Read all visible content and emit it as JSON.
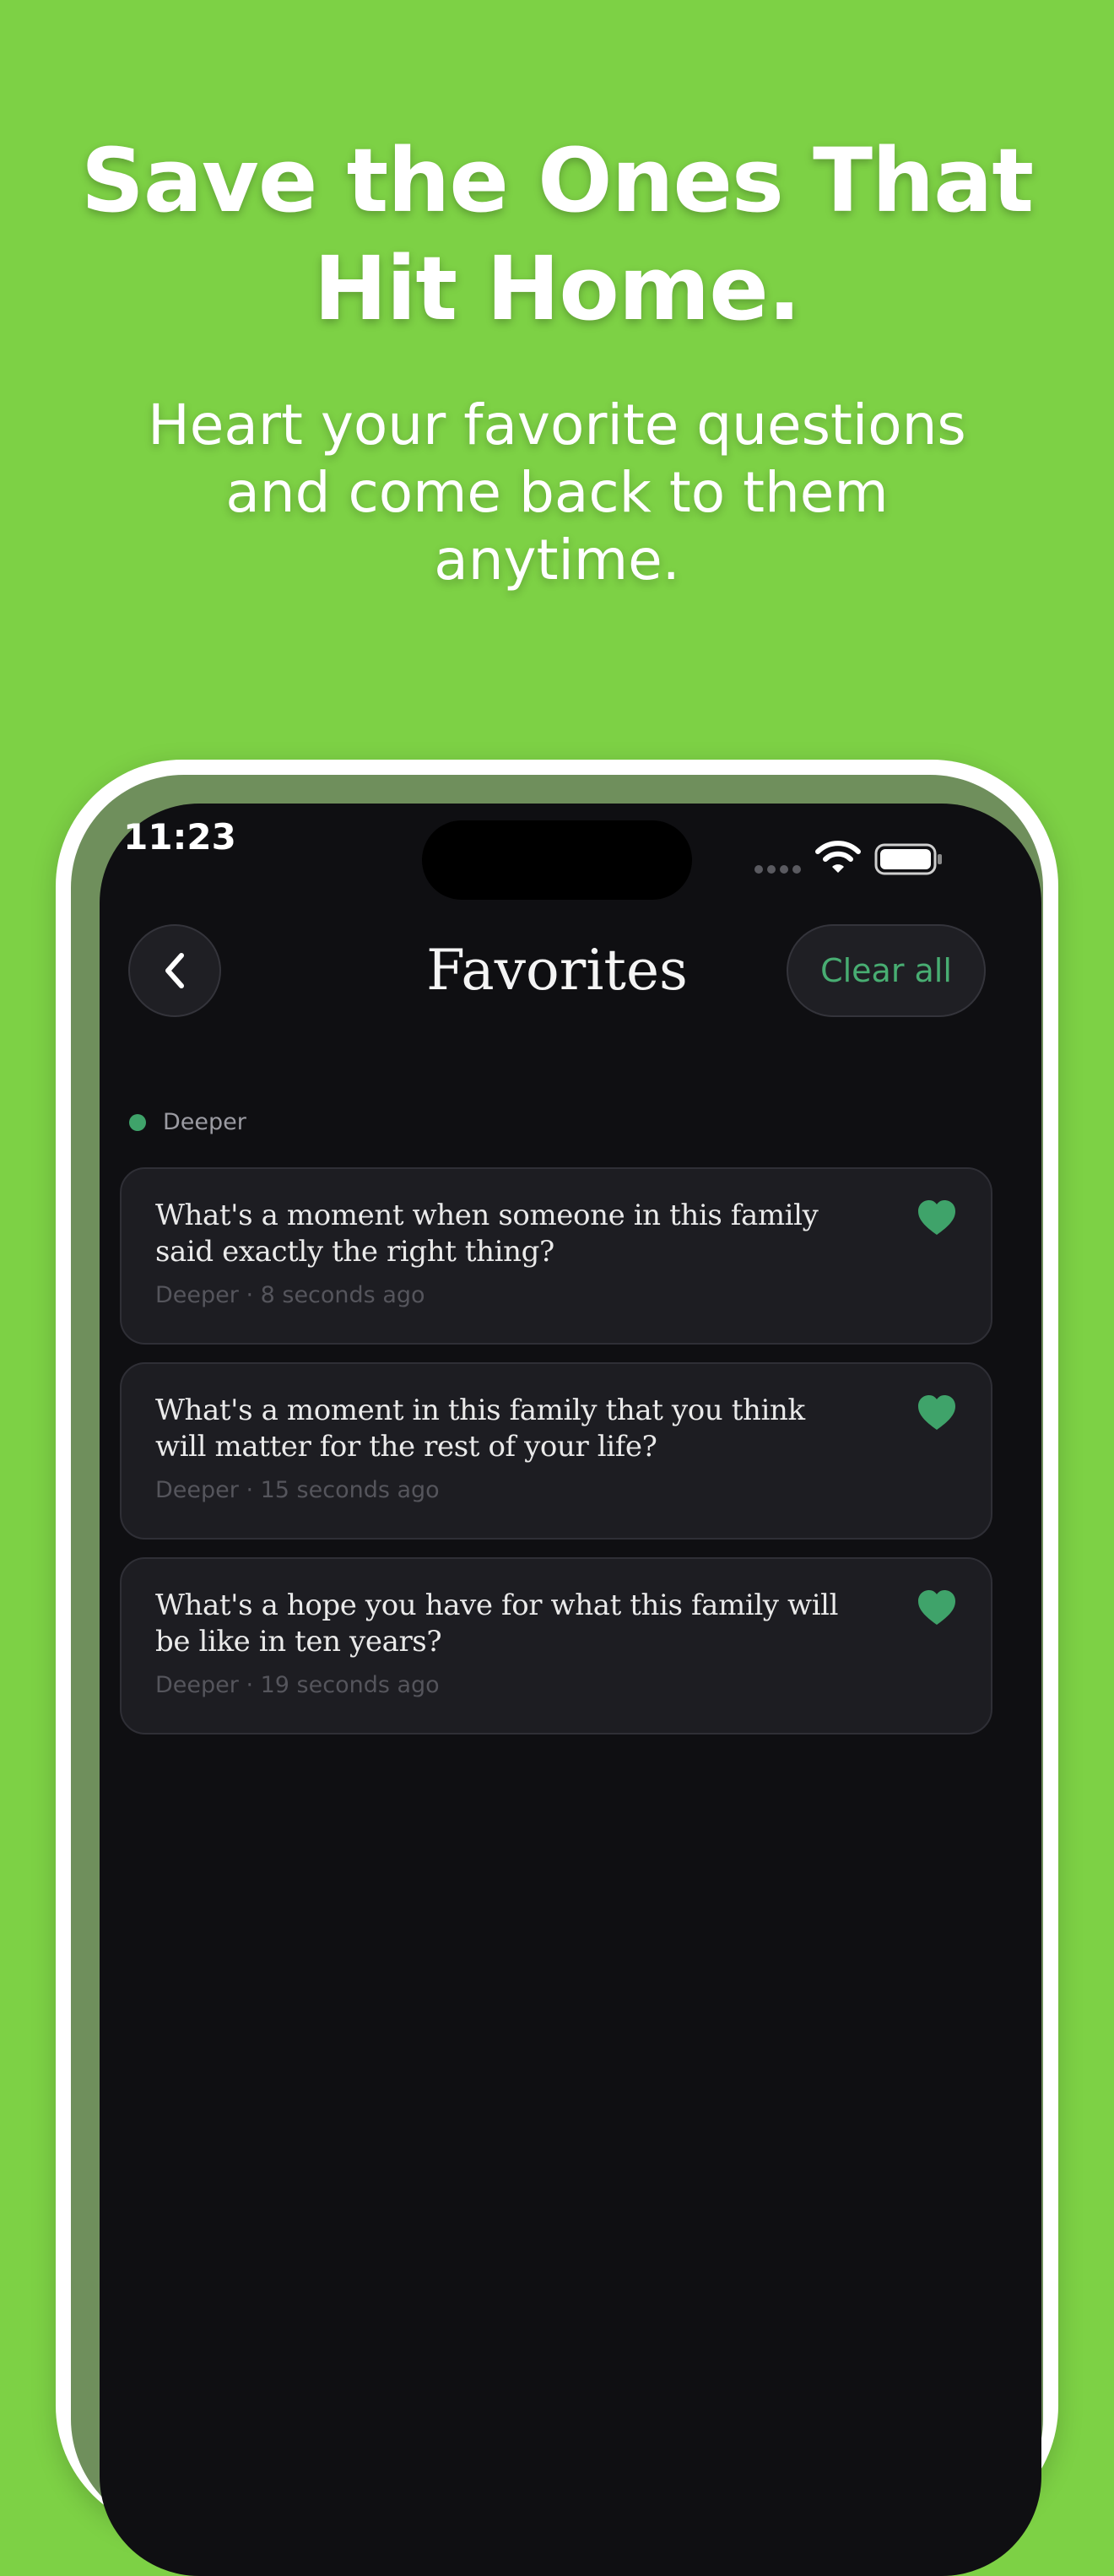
{
  "promo": {
    "title_line1": "Save the Ones That",
    "title_line2": "Hit Home.",
    "subtitle_line1": "Heart your favorite questions",
    "subtitle_line2": "and come back to them",
    "subtitle_line3": "anytime."
  },
  "status_bar": {
    "time": "11:23",
    "icons": [
      "signal-icon",
      "wifi-icon",
      "battery-icon"
    ]
  },
  "header": {
    "title": "Favorites",
    "back_icon": "chevron-left-icon",
    "clear_all_label": "Clear all"
  },
  "section": {
    "label": "Deeper",
    "dot_color": "#3fa36a"
  },
  "favorites": [
    {
      "question_line1": "What's a moment when someone in this family",
      "question_line2": "said exactly the right thing?",
      "meta": "Deeper · 8 seconds ago",
      "favorited": true
    },
    {
      "question_line1": "What's a moment in this family that you think",
      "question_line2": "will matter for the rest of your life?",
      "meta": "Deeper · 15 seconds ago",
      "favorited": true
    },
    {
      "question_line1": "What's a hope you have for what this family will",
      "question_line2": "be like in ten years?",
      "meta": "Deeper · 19 seconds ago",
      "favorited": true
    }
  ],
  "colors": {
    "background": "#7dd145",
    "screen": "#0f0f12",
    "card": "#1d1d22",
    "accent": "#48ad72",
    "heart": "#3fa36a"
  }
}
